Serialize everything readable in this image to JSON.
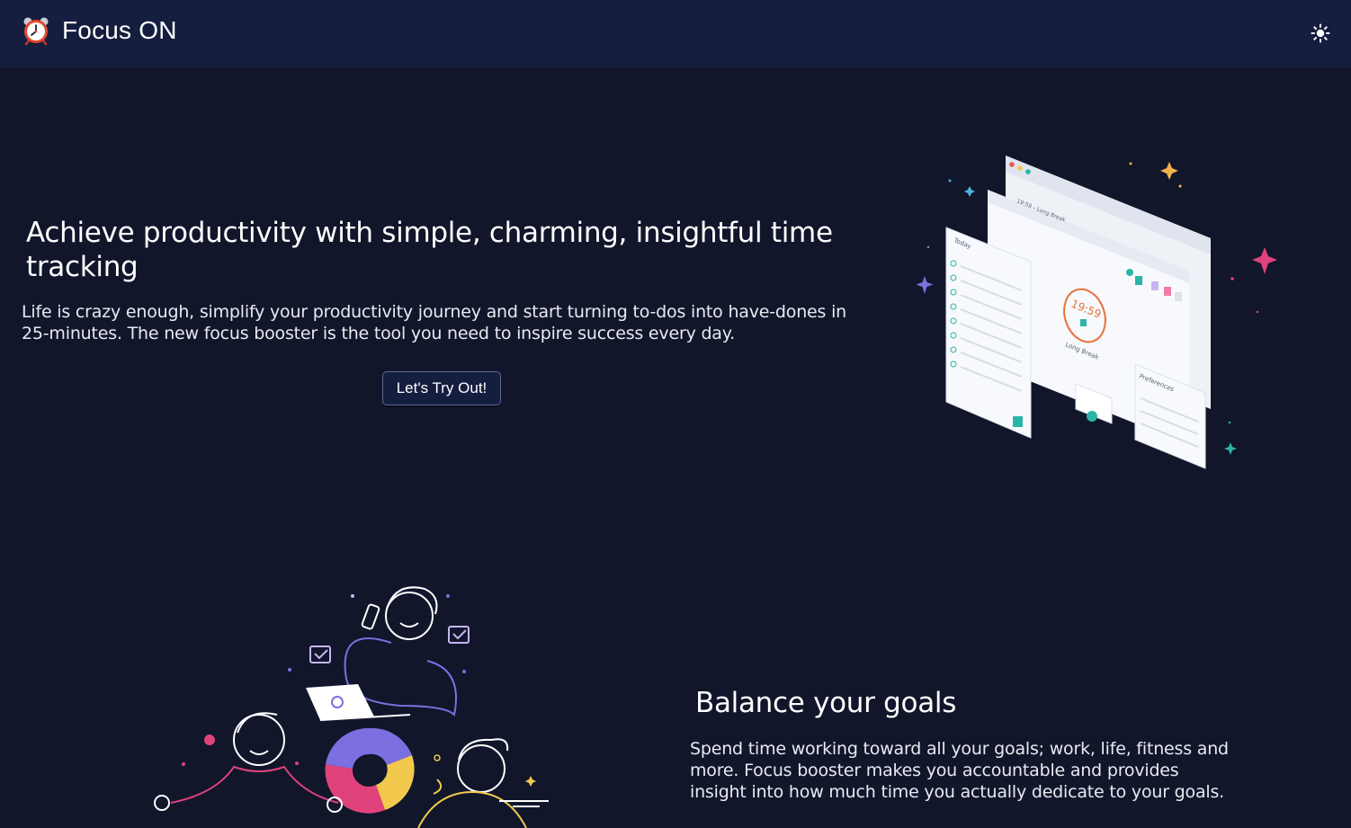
{
  "app": {
    "title": "Focus ON",
    "logo_icon": "alarm-clock-icon",
    "theme_toggle_icon": "sun-icon"
  },
  "hero": {
    "title": "Achieve productivity with simple, charming, insightful time tracking",
    "subtitle": "Life is crazy enough, simplify your productivity journey and start turning to-dos into have-dones in 25-minutes. The new focus booster is the tool you need to inspire success every day.",
    "cta_label": "Let's Try Out!",
    "illustration": {
      "today_label": "Today",
      "timer_value": "19:59",
      "timer_mode": "Long Break",
      "header_strip": "19:59 – Long Break",
      "preferences_label": "Preferences"
    }
  },
  "goals": {
    "title": "Balance your goals",
    "text": "Spend time working toward all your goals; work, life, fitness and more. Focus booster makes you accountable and provides insight into how much time you actually dedicate to your goals."
  },
  "colors": {
    "background": "#11162b",
    "navbar": "#151e3f",
    "accent_teal": "#2bb5a8",
    "accent_pink": "#e0437c",
    "accent_purple": "#7c6fe0",
    "accent_yellow": "#f2c94c",
    "accent_orange": "#e8703a"
  }
}
